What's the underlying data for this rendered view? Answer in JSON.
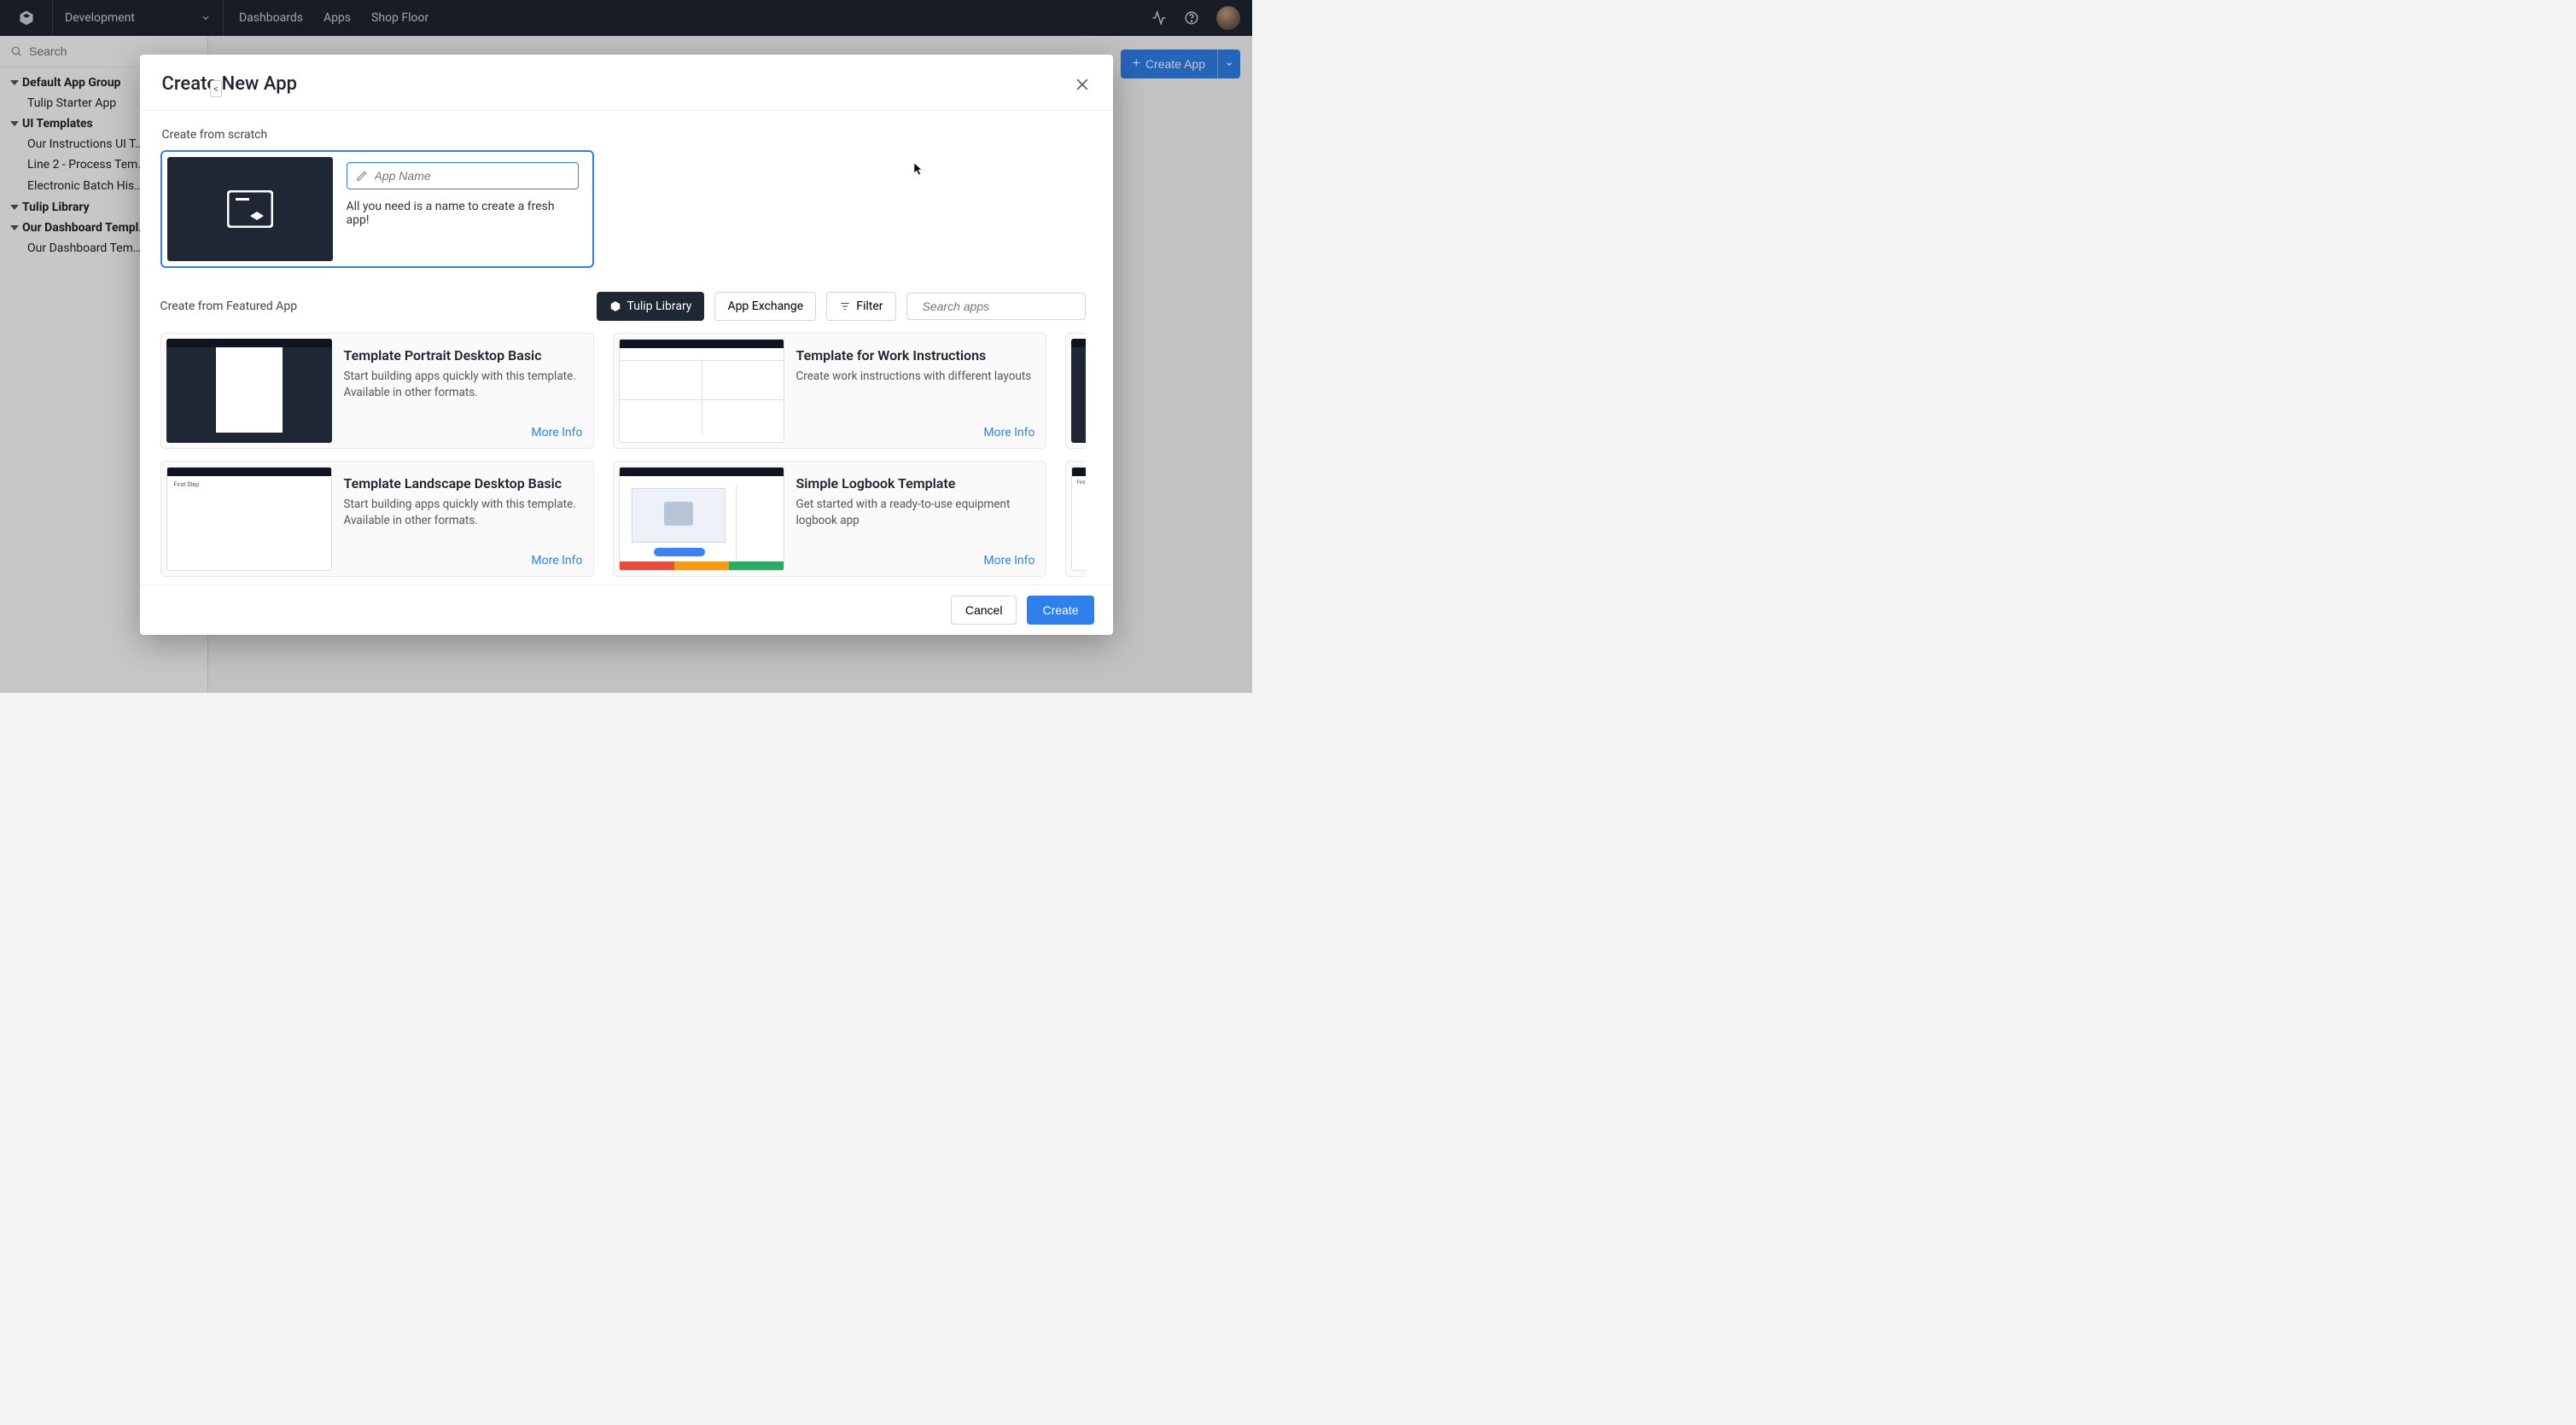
{
  "topnav": {
    "environment": "Development",
    "links": [
      "Dashboards",
      "Apps",
      "Shop Floor"
    ]
  },
  "sidebar": {
    "search_placeholder": "Search",
    "groups": [
      {
        "label": "Default App Group",
        "children": [
          "Tulip Starter App"
        ]
      },
      {
        "label": "UI Templates",
        "children": [
          "Our Instructions UI T…",
          "Line 2 - Process Tem…",
          "Electronic Batch His… Template"
        ]
      },
      {
        "label": "Tulip Library",
        "children": []
      },
      {
        "label": "Our Dashboard Templ…",
        "children": [
          "Our Dashboard Tem…"
        ]
      }
    ]
  },
  "create_app_button": "Create App",
  "modal": {
    "title": "Create New App",
    "scratch_label": "Create from scratch",
    "name_placeholder": "App Name",
    "scratch_hint": "All you need is a name to create a fresh app!",
    "featured_label": "Create from Featured App",
    "tabs": {
      "library": "Tulip Library",
      "exchange": "App Exchange",
      "filter": "Filter"
    },
    "search_placeholder": "Search apps",
    "templates": [
      {
        "title": "Template Portrait Desktop Basic",
        "desc": "Start building apps quickly with this template. Available in other formats.",
        "more": "More Info"
      },
      {
        "title": "Template for Work Instructions",
        "desc": "Create work instructions with different layouts",
        "more": "More Info"
      },
      {
        "title": "Template Landscape Desktop Basic",
        "desc": "Start building apps quickly with this template. Available in other formats.",
        "more": "More Info"
      },
      {
        "title": "Simple Logbook Template",
        "desc": "Get started with a ready-to-use equipment logbook app",
        "more": "More Info"
      }
    ],
    "cancel": "Cancel",
    "create": "Create"
  }
}
